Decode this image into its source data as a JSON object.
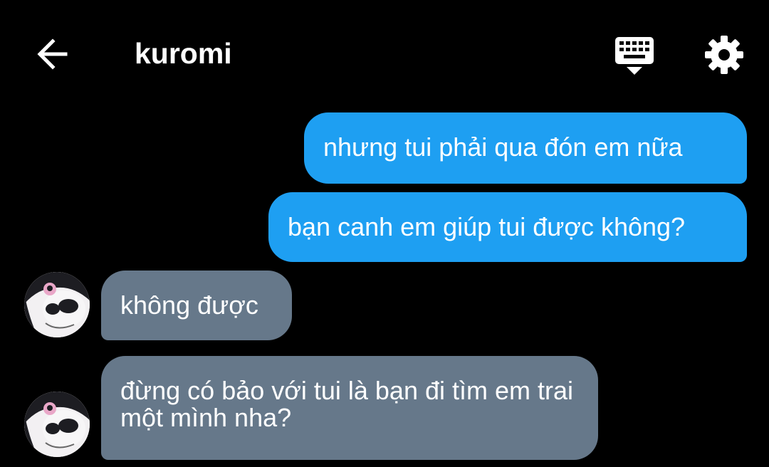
{
  "header": {
    "back_icon": "arrow-left-icon",
    "title": "kuromi",
    "keyboard_icon": "keyboard-icon",
    "settings_icon": "gear-icon"
  },
  "messages": [
    {
      "direction": "sent",
      "text": "nhưng tui phải qua đón em nữa"
    },
    {
      "direction": "sent",
      "text": "bạn canh em giúp tui được không?"
    },
    {
      "direction": "received",
      "text": "không được",
      "avatar": "kuromi-avatar"
    },
    {
      "direction": "received",
      "text": "đừng có bảo với tui là bạn đi tìm em trai một mình nha?",
      "avatar": "kuromi-avatar"
    }
  ],
  "colors": {
    "background": "#000000",
    "sent_bubble": "#1e9ff2",
    "received_bubble": "#66788a",
    "text": "#ffffff"
  }
}
